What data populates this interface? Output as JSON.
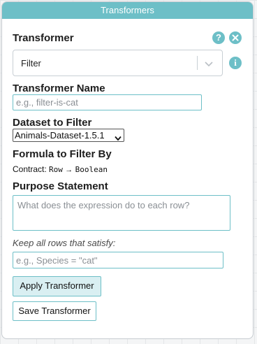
{
  "panel": {
    "title": "Transformers"
  },
  "transformer": {
    "heading": "Transformer",
    "help_icon": "question-mark",
    "close_icon": "x",
    "info_icon": "i",
    "selected": "Filter"
  },
  "name": {
    "heading": "Transformer Name",
    "placeholder": "e.g., filter-is-cat"
  },
  "dataset": {
    "heading": "Dataset to Filter",
    "selected": "Animals-Dataset-1.5.1"
  },
  "formula": {
    "heading": "Formula to Filter By",
    "contract_label": "Contract:",
    "contract_in": "Row",
    "arrow": "→",
    "contract_out": "Boolean"
  },
  "purpose": {
    "heading": "Purpose Statement",
    "placeholder": "What does the expression do to each row?"
  },
  "keep": {
    "label": "Keep all rows that satisfy:",
    "placeholder": "e.g., Species = \"cat\""
  },
  "buttons": {
    "apply": "Apply Transformer",
    "save": "Save Transformer"
  },
  "colors": {
    "accent": "#6dbfc7",
    "apply_bg": "#d9eff2"
  }
}
